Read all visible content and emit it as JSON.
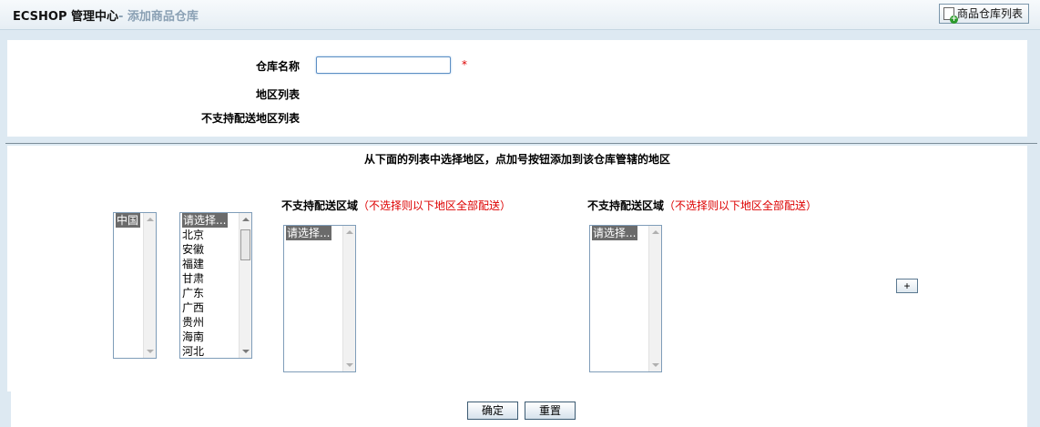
{
  "header": {
    "brand": "ECSHOP 管理中心",
    "subtitle": "- 添加商品仓库",
    "list_button": "商品仓库列表"
  },
  "form": {
    "name_label": "仓库名称",
    "name_value": "",
    "required_mark": "*",
    "region_list_label": "地区列表",
    "unsupported_label": "不支持配送地区列表"
  },
  "region_panel": {
    "hint": "从下面的列表中选择地区，点加号按钮添加到该仓库管辖的地区",
    "country_options": [
      "中国"
    ],
    "province_options": [
      "请选择...",
      "北京",
      "安徽",
      "福建",
      "甘肃",
      "广东",
      "广西",
      "贵州",
      "海南",
      "河北"
    ],
    "city_title": "不支持配送区域",
    "city_note": "（不选择则以下地区全部配送）",
    "city_options": [
      "请选择..."
    ],
    "district_title": "不支持配送区域",
    "district_note": "（不选择则以下地区全部配送）",
    "district_options": [
      "请选择..."
    ],
    "add_button": "+"
  },
  "actions": {
    "submit": "确定",
    "reset": "重置"
  }
}
